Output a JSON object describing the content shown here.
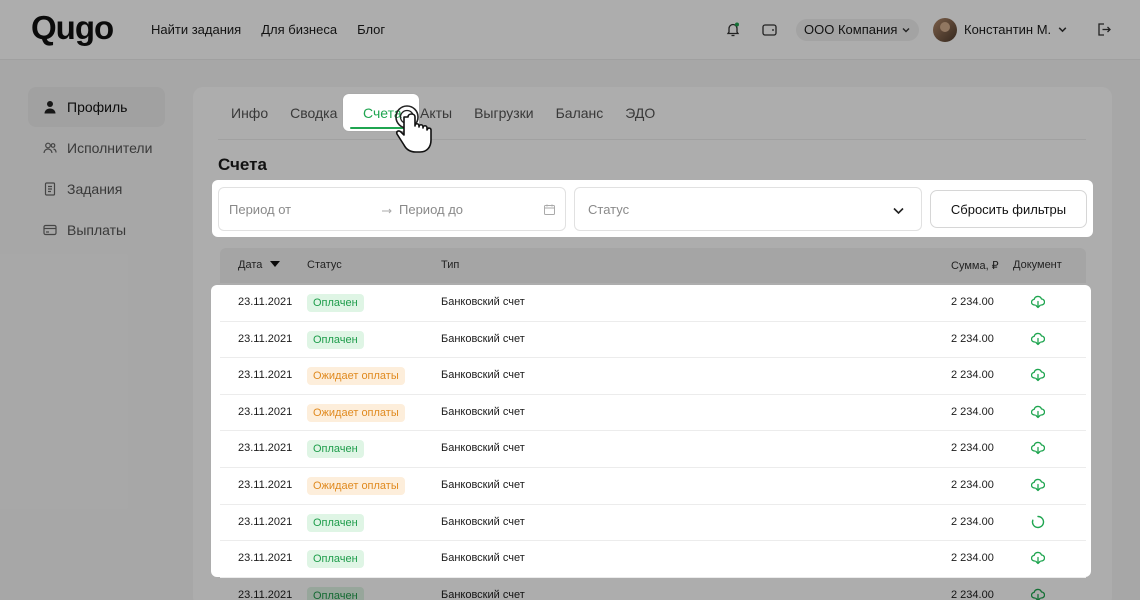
{
  "header": {
    "logo": "Qugo",
    "nav": [
      "Найти задания",
      "Для бизнеса",
      "Блог"
    ],
    "company": "ООО Компания",
    "user_name": "Константин М."
  },
  "sidebar": {
    "items": [
      {
        "label": "Профиль",
        "icon": "user-icon",
        "active": true
      },
      {
        "label": "Исполнители",
        "icon": "users-icon",
        "active": false
      },
      {
        "label": "Задания",
        "icon": "document-icon",
        "active": false
      },
      {
        "label": "Выплаты",
        "icon": "card-icon",
        "active": false
      }
    ]
  },
  "tabs": [
    {
      "label": "Инфо",
      "active": false
    },
    {
      "label": "Сводка",
      "active": false
    },
    {
      "label": "Счета",
      "active": true
    },
    {
      "label": "Акты",
      "active": false
    },
    {
      "label": "Выгрузки",
      "active": false
    },
    {
      "label": "Баланс",
      "active": false
    },
    {
      "label": "ЭДО",
      "active": false
    }
  ],
  "section_title": "Счета",
  "filters": {
    "period_from": "Период от",
    "period_to": "Период до",
    "status_placeholder": "Статус",
    "reset_label": "Сбросить фильтры"
  },
  "table": {
    "headers": {
      "date": "Дата",
      "status": "Статус",
      "type": "Тип",
      "amount": "Сумма, ₽",
      "document": "Документ"
    },
    "rows": [
      {
        "date": "23.11.2021",
        "status": "Оплачен",
        "status_kind": "paid",
        "type": "Банковский счет",
        "amount": "2 234.00",
        "doc": "download"
      },
      {
        "date": "23.11.2021",
        "status": "Оплачен",
        "status_kind": "paid",
        "type": "Банковский счет",
        "amount": "2 234.00",
        "doc": "download"
      },
      {
        "date": "23.11.2021",
        "status": "Ожидает оплаты",
        "status_kind": "wait",
        "type": "Банковский счет",
        "amount": "2 234.00",
        "doc": "download"
      },
      {
        "date": "23.11.2021",
        "status": "Ожидает оплаты",
        "status_kind": "wait",
        "type": "Банковский счет",
        "amount": "2 234.00",
        "doc": "download"
      },
      {
        "date": "23.11.2021",
        "status": "Оплачен",
        "status_kind": "paid",
        "type": "Банковский счет",
        "amount": "2 234.00",
        "doc": "download"
      },
      {
        "date": "23.11.2021",
        "status": "Ожидает оплаты",
        "status_kind": "wait",
        "type": "Банковский счет",
        "amount": "2 234.00",
        "doc": "download"
      },
      {
        "date": "23.11.2021",
        "status": "Оплачен",
        "status_kind": "paid",
        "type": "Банковский счет",
        "amount": "2 234.00",
        "doc": "loading"
      },
      {
        "date": "23.11.2021",
        "status": "Оплачен",
        "status_kind": "paid",
        "type": "Банковский счет",
        "amount": "2 234.00",
        "doc": "download"
      },
      {
        "date": "23.11.2021",
        "status": "Оплачен",
        "status_kind": "paid",
        "type": "Банковский счет",
        "amount": "2 234.00",
        "doc": "download"
      }
    ]
  },
  "colors": {
    "accent": "#1fa550",
    "paid_bg": "#dff5e5",
    "wait_bg": "#fdeedb",
    "wait_text": "#e08a1f"
  }
}
